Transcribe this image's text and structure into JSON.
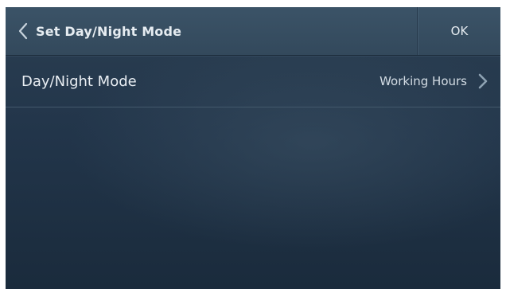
{
  "header": {
    "back_icon": "chevron-left-icon",
    "title": "Set Day/Night Mode",
    "ok_label": "OK"
  },
  "rows": [
    {
      "label": "Day/Night Mode",
      "value": "Working Hours",
      "icon": "chevron-right-icon"
    }
  ],
  "colors": {
    "background": "#22354a",
    "header": "#3b5367",
    "text": "#e6ecf1",
    "chevron": "#8ea2b3"
  }
}
